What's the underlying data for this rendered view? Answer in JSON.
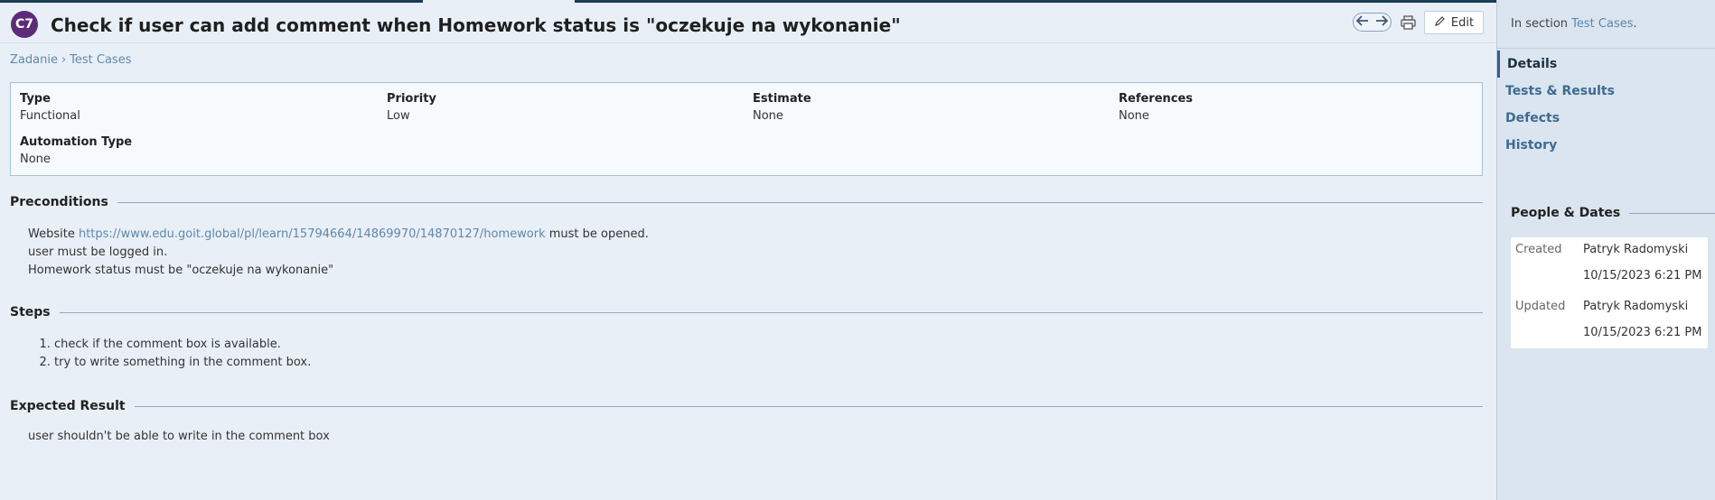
{
  "header": {
    "case_id": "C7",
    "title": "Check if user can add comment when Homework status is \"oczekuje na wykonanie\"",
    "prev_icon": "arrow-left-icon",
    "next_icon": "arrow-right-icon",
    "print_icon": "printer-icon",
    "edit_label": "Edit",
    "edit_icon": "pencil-icon"
  },
  "breadcrumb": {
    "items": [
      "Zadanie",
      "Test Cases"
    ],
    "separator": "›"
  },
  "fields": {
    "type": {
      "label": "Type",
      "value": "Functional"
    },
    "priority": {
      "label": "Priority",
      "value": "Low"
    },
    "estimate": {
      "label": "Estimate",
      "value": "None"
    },
    "references": {
      "label": "References",
      "value": "None"
    },
    "automation_type": {
      "label": "Automation Type",
      "value": "None"
    }
  },
  "preconditions": {
    "title": "Preconditions",
    "line1_prefix": "Website ",
    "line1_link": "https://www.edu.goit.global/pl/learn/15794664/14869970/14870127/homework",
    "line1_suffix": " must be opened.",
    "line2": "user must be logged in.",
    "line3": "Homework status must be \"oczekuje na wykonanie\""
  },
  "steps": {
    "title": "Steps",
    "items": [
      "check if the comment box is available.",
      "try to write something in the comment box."
    ]
  },
  "expected_result": {
    "title": "Expected Result",
    "text": "user shouldn't be able to write in the comment box"
  },
  "sidebar": {
    "section_prefix": "In section ",
    "section_link": "Test Cases",
    "section_suffix": ".",
    "nav": [
      {
        "label": "Details",
        "active": true
      },
      {
        "label": "Tests & Results",
        "active": false
      },
      {
        "label": "Defects",
        "active": false
      },
      {
        "label": "History",
        "active": false
      }
    ],
    "people_title": "People & Dates",
    "created_label": "Created",
    "created_by": "Patryk Radomyski",
    "created_date": "10/15/2023 6:21 PM",
    "updated_label": "Updated",
    "updated_by": "Patryk Radomyski",
    "updated_date": "10/15/2023 6:21 PM"
  },
  "colors": {
    "badge": "#5d2b79",
    "link": "#5e88ac",
    "background": "#e9eff6",
    "sidebar": "#dae5ef"
  }
}
